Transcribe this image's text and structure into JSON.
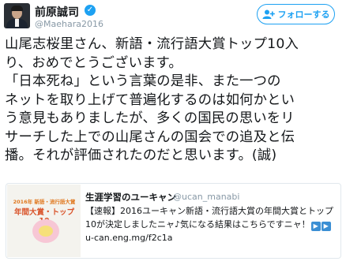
{
  "header": {
    "name": "前原誠司",
    "handle": "@Maehara2016",
    "follow_label": "フォローする"
  },
  "tweet": {
    "text": "山尾志桜里さん、新語・流行語大賞トップ10入\nり、おめでとうございます。\n「日本死ね」という言葉の是非、また一つの\nネットを取り上げて普遍化するのは如何かとい\nう意見もありましたが、多くの国民の思いをリ\nサーチした上での山尾さんの国会での追及と伝\n播。それが評価されたのだと思います。(誠)"
  },
  "card": {
    "thumb_line1": "2016年 新語・流行語大賞",
    "thumb_line2": "年間大賞・トップ10",
    "title": "生涯学習のユーキャン",
    "handle": "@ucan_manabi",
    "desc_before": "【速報】2016ユーキャン新語・流行語大賞の年間大賞とトップ10が決定しましたニャ♪気になる結果はこちらですニャ！",
    "play1": "▶",
    "play2": "▶",
    "desc_after": " u-can.eng.mg/f2c1a"
  },
  "colors": {
    "accent": "#1da1f2",
    "text": "#14171a",
    "muted": "#8899a6",
    "border": "#e1e8ed"
  }
}
